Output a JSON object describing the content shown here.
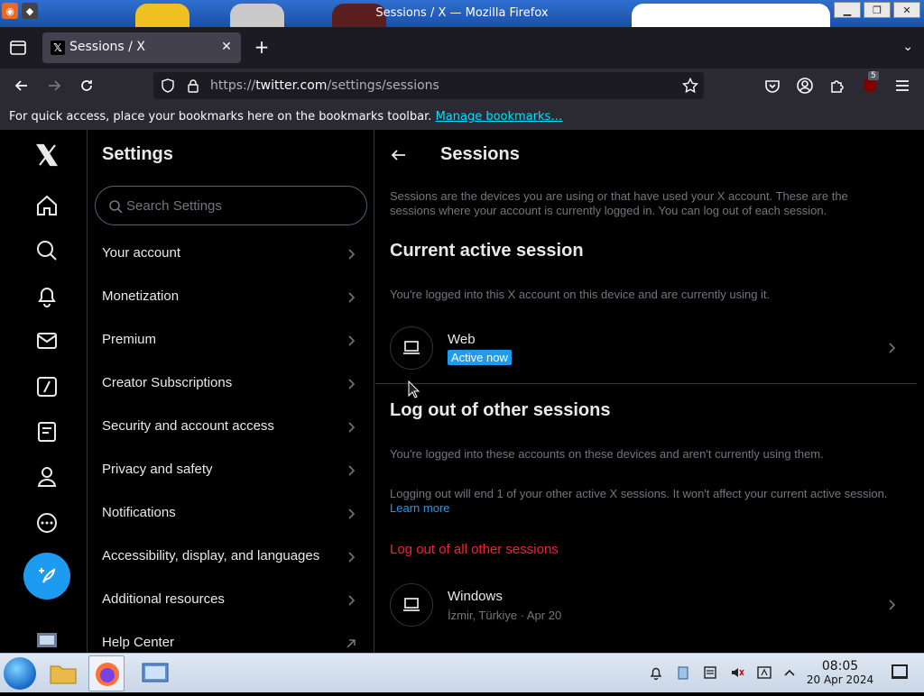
{
  "window": {
    "title": "Sessions / X — Mozilla Firefox"
  },
  "browser": {
    "tab_title": "Sessions / X",
    "url_prefix": "https://",
    "url_host": "twitter.com",
    "url_path": "/settings/sessions",
    "extension_badge": "5",
    "bookmarks_text": "For quick access, place your bookmarks here on the bookmarks toolbar.",
    "bookmarks_link": "Manage bookmarks…"
  },
  "settings": {
    "title": "Settings",
    "search_placeholder": "Search Settings",
    "items": [
      "Your account",
      "Monetization",
      "Premium",
      "Creator Subscriptions",
      "Security and account access",
      "Privacy and safety",
      "Notifications",
      "Accessibility, display, and languages",
      "Additional resources",
      "Help Center"
    ]
  },
  "sessions": {
    "title": "Sessions",
    "description": "Sessions are the devices you are using or that have used your X account. These are the sessions where your account is currently logged in. You can log out of each session.",
    "current_heading": "Current active session",
    "current_sub": "You're logged into this X account on this device and are currently using it.",
    "current_device": "Web",
    "active_label": "Active now",
    "other_heading": "Log out of other sessions",
    "other_sub": "You're logged into these accounts on these devices and aren't currently using them.",
    "logout_note": "Logging out will end 1 of your other active X sessions. It won't affect your current active session.",
    "learn_more": "Learn more",
    "logout_all": "Log out of all other sessions",
    "other_device": "Windows",
    "other_meta": "İzmir, Türkiye · Apr 20"
  },
  "taskbar": {
    "time": "08:05",
    "date": "20 Apr 2024"
  },
  "colors": {
    "accent": "#1d9bf0",
    "danger": "#f4212e",
    "muted": "#71767b",
    "text": "#e7e9ea"
  }
}
